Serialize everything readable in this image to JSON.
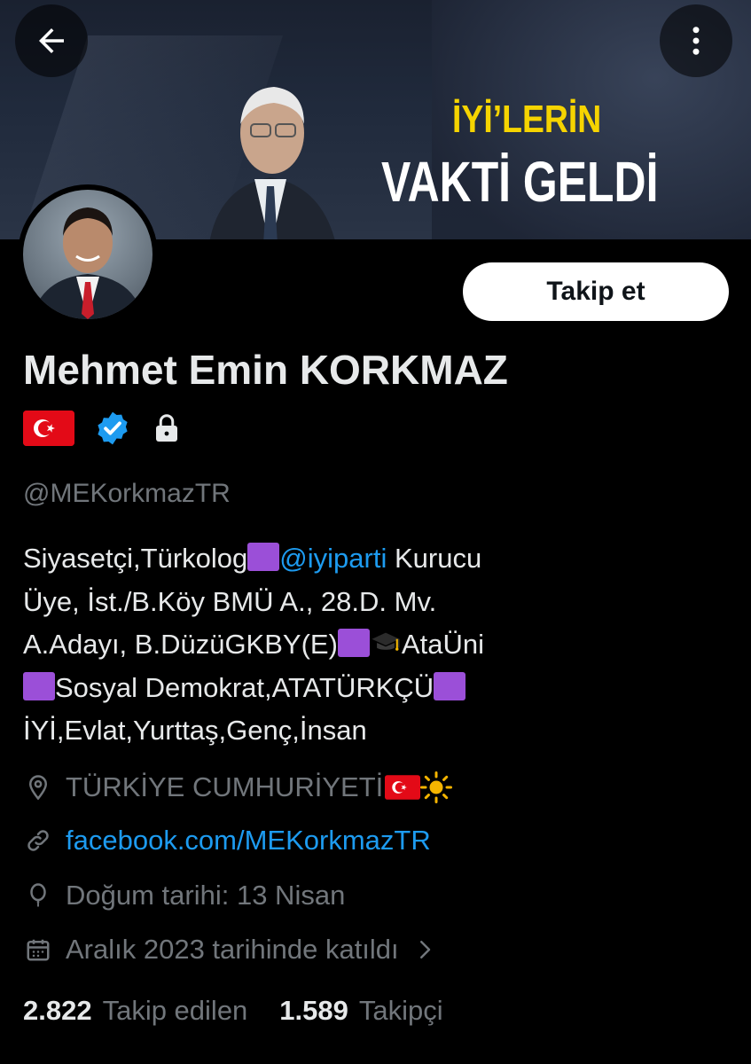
{
  "banner": {
    "slogan_line1": "İYİ’LERİN",
    "slogan_line2": "VAKTİ GELDİ"
  },
  "header": {
    "back_icon": "arrow-left-icon",
    "more_icon": "more-vertical-icon"
  },
  "profile": {
    "follow_label": "Takip et",
    "display_name": "Mehmet Emin KORKMAZ",
    "handle": "@MEKorkmazTR",
    "bio": {
      "line1_a": "Siyasetçi,Türkolog",
      "line1_mention": "@iyiparti",
      "line1_b": " Kurucu",
      "line2": "Üye, İst./B.Köy BMÜ A., 28.D. Mv.",
      "line3_a": "A.Adayı, B.DüzüGKBY(E)",
      "line3_b": "AtaÜni",
      "line4_a": "Sosyal Demokrat,ATATÜRKÇÜ",
      "line5": "İYİ,Evlat,Yurttaş,Genç,İnsan"
    },
    "location": "TÜRKİYE CUMHURİYETİ",
    "website": "facebook.com/MEKorkmazTR",
    "birthday": "Doğum tarihi: 13 Nisan",
    "joined": "Aralık 2023 tarihinde katıldı"
  },
  "stats": {
    "following_count": "2.822",
    "following_label": "Takip edilen",
    "followers_count": "1.589",
    "followers_label": "Takipçi"
  },
  "colors": {
    "background": "#000000",
    "accent": "#1d9bf0",
    "muted": "#71767b",
    "text": "#e7e9ea",
    "emoji_square": "#9b4fd8"
  }
}
